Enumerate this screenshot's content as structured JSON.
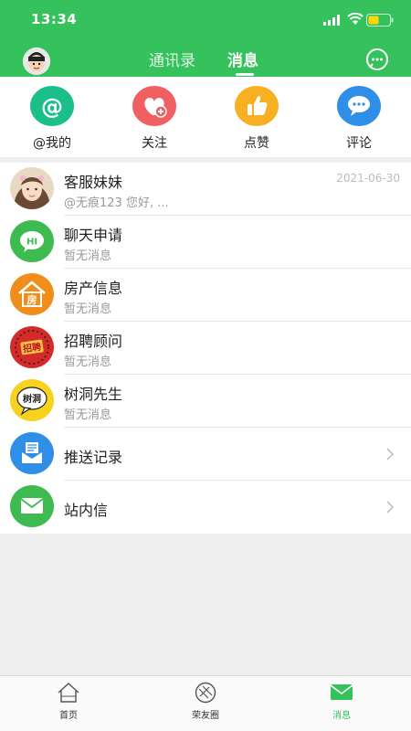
{
  "status_bar": {
    "time": "13:34"
  },
  "header": {
    "tabs": [
      {
        "label": "通讯录",
        "active": false
      },
      {
        "label": "消息",
        "active": true
      }
    ],
    "accent_color": "#35c15b"
  },
  "quick_actions": [
    {
      "label": "@我的",
      "icon": "at-icon",
      "color": "#1bbf8a"
    },
    {
      "label": "关注",
      "icon": "heart-plus-icon",
      "color": "#f06062"
    },
    {
      "label": "点赞",
      "icon": "thumbs-up-icon",
      "color": "#f7b021"
    },
    {
      "label": "评论",
      "icon": "comment-icon",
      "color": "#2f8ee8"
    }
  ],
  "messages": [
    {
      "title": "客服妹妹",
      "subtitle": "@无痕123 您好, ...",
      "time": "2021-06-30",
      "icon": "service-avatar"
    },
    {
      "title": "聊天申请",
      "subtitle": "暂无消息",
      "icon": "hi-chat-icon"
    },
    {
      "title": "房产信息",
      "subtitle": "暂无消息",
      "icon": "house-icon",
      "badge_text": "房"
    },
    {
      "title": "招聘顾问",
      "subtitle": "暂无消息",
      "icon": "recruit-icon",
      "badge_text": "招聘"
    },
    {
      "title": "树洞先生",
      "subtitle": "暂无消息",
      "icon": "tree-hole-icon",
      "badge_text": "树洞"
    },
    {
      "title": "推送记录",
      "icon": "push-record-icon"
    },
    {
      "title": "站内信",
      "icon": "mail-icon"
    }
  ],
  "tabbar": [
    {
      "label": "首页",
      "icon": "home-icon",
      "active": false
    },
    {
      "label": "荣友圈",
      "icon": "circle-icon",
      "active": false
    },
    {
      "label": "消息",
      "icon": "message-icon",
      "active": true
    }
  ]
}
